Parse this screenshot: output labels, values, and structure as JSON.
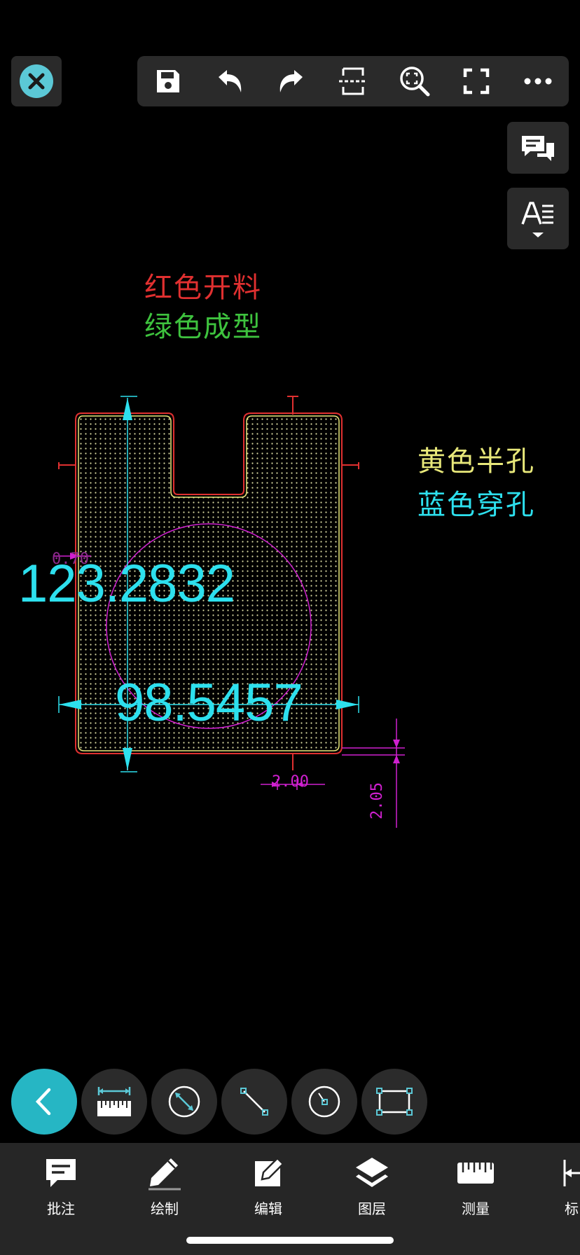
{
  "toolbar": {
    "close": "close-icon",
    "icons": [
      "save-icon",
      "undo-icon",
      "redo-icon",
      "split-view-icon",
      "zoom-fit-icon",
      "fullscreen-icon",
      "more-icon"
    ]
  },
  "side_buttons": [
    "comment-list-icon",
    "text-style-icon"
  ],
  "drawing": {
    "legend_red": "红色开料",
    "legend_green": "绿色成型",
    "legend_yellow": "黄色半孔",
    "legend_blue": "蓝色穿孔",
    "dim_vertical": "123.2832",
    "dim_horizontal": "98.5457",
    "dim_small_h": "2.00",
    "dim_small_v": "2.05",
    "dim_faint": "0.70",
    "colors": {
      "red": "#e03030",
      "green": "#3ec23e",
      "yellow": "#e8e87a",
      "cyan": "#2de0ee",
      "magenta": "#d020d0",
      "dots": "#d8d8a0"
    }
  },
  "measure_tools": {
    "active": "back-icon",
    "icons": [
      "back-icon",
      "ruler-distance-icon",
      "circle-diameter-icon",
      "line-measure-icon",
      "radius-icon",
      "rectangle-area-icon"
    ]
  },
  "bottom_nav": {
    "items": [
      {
        "label": "批注",
        "icon": "annotation-icon"
      },
      {
        "label": "绘制",
        "icon": "draw-pencil-icon"
      },
      {
        "label": "编辑",
        "icon": "edit-icon"
      },
      {
        "label": "图层",
        "icon": "layers-icon"
      },
      {
        "label": "测量",
        "icon": "measure-ruler-icon"
      },
      {
        "label": "标",
        "icon": "dimension-icon"
      }
    ]
  },
  "accent_color": "#26b6c4"
}
